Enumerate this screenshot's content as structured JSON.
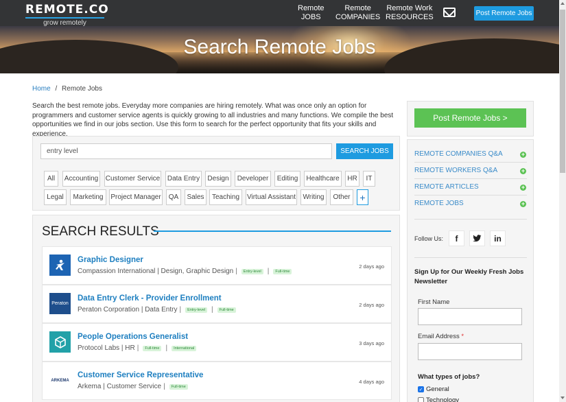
{
  "header": {
    "logo": "REMOTE.CO",
    "tagline": "grow remotely",
    "nav": [
      {
        "line1": "Remote",
        "line2": "JOBS"
      },
      {
        "line1": "Remote",
        "line2": "COMPANIES"
      },
      {
        "line1": "Remote Work",
        "line2": "RESOURCES"
      }
    ],
    "mail_icon": "envelope-icon",
    "post_button": "Post Remote Jobs"
  },
  "hero": {
    "title": "Search Remote Jobs"
  },
  "breadcrumb": {
    "home": "Home",
    "separator": "/",
    "current": "Remote Jobs"
  },
  "intro": "Search the best remote jobs. Everyday more companies are hiring remotely. What was once only an option for programmers and customer service agents is quickly growing to all industries and many functions. We compile the best opportunities we find in our jobs section. Use this form to search for the perfect opportunity that fits your skills and experience.",
  "search": {
    "value": "entry level",
    "button": "SEARCH JOBS"
  },
  "tags": [
    "All",
    "Accounting",
    "Customer Service",
    "Data Entry",
    "Design",
    "Developer",
    "Editing",
    "Healthcare",
    "HR",
    "IT",
    "Legal",
    "Marketing",
    "Project Manager",
    "QA",
    "Sales",
    "Teaching",
    "Virtual Assistant",
    "Writing",
    "Other",
    "+"
  ],
  "results": {
    "title": "SEARCH RESULTS",
    "jobs": [
      {
        "title": "Graphic Designer",
        "company": "Compassion International | Design, Graphic Design",
        "badges": [
          "Entry-level",
          "Full-time"
        ],
        "date": "2 days ago",
        "logo_text": "",
        "logo_color": "#1d64b3"
      },
      {
        "title": "Data Entry Clerk - Provider Enrollment",
        "company": "Peraton Corporation | Data Entry",
        "badges": [
          "Entry-level",
          "Full-time"
        ],
        "date": "2 days ago",
        "logo_text": "Peraton",
        "logo_color": "#1e4e8c"
      },
      {
        "title": "People Operations Generalist",
        "company": "Protocol Labs | HR",
        "badges": [
          "Full-time",
          "International"
        ],
        "date": "3 days ago",
        "logo_text": "",
        "logo_color": "#22a1a8"
      },
      {
        "title": "Customer Service Representative",
        "company": "Arkema | Customer Service",
        "badges": [
          "Full-time"
        ],
        "date": "4 days ago",
        "logo_text": "ARKEMA",
        "logo_color": "#ffffff"
      }
    ]
  },
  "sidebar": {
    "post_button": "Post Remote Jobs >",
    "links": [
      "REMOTE COMPANIES Q&A",
      "REMOTE WORKERS Q&A",
      "REMOTE ARTICLES",
      "REMOTE JOBS"
    ],
    "follow_label": "Follow Us:",
    "social": [
      "f",
      "t",
      "in"
    ],
    "newsletter_title": "Sign Up for Our Weekly Fresh Jobs Newsletter",
    "first_name_label": "First Name",
    "email_label": "Email Address",
    "required_mark": "*",
    "job_types_question": "What types of jobs?",
    "job_types": [
      {
        "label": "General",
        "checked": true
      },
      {
        "label": "Technology",
        "checked": false
      }
    ]
  }
}
